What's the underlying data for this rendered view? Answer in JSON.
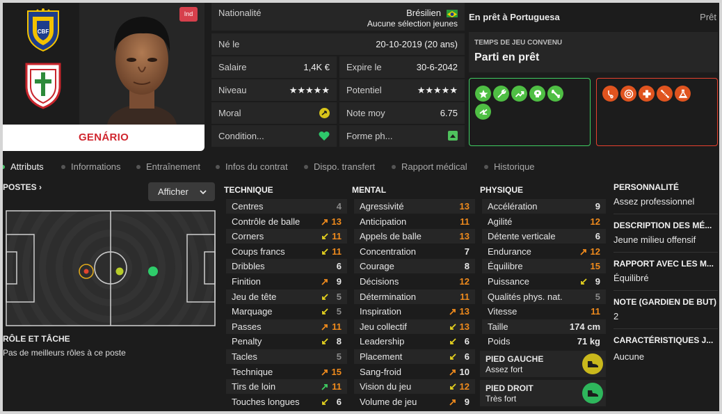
{
  "player": {
    "name": "GENÁRIO",
    "tag": "Ind"
  },
  "info": {
    "nationality_label": "Nationalité",
    "nationality_value": "Brésilien",
    "youth_caps": "Aucune sélection jeunes",
    "born_label": "Né le",
    "born_value": "20-10-2019 (20 ans)",
    "salary_label": "Salaire",
    "salary_value": "1,4K €",
    "expires_label": "Expire le",
    "expires_value": "30-6-2042",
    "level_label": "Niveau",
    "level_stars": "★★★★★",
    "potential_label": "Potentiel",
    "potential_stars": "★★★★★",
    "morale_label": "Moral",
    "avg_rating_label": "Note moy",
    "avg_rating_value": "6.75",
    "condition_label": "Condition...",
    "form_label": "Forme ph..."
  },
  "loan": {
    "title": "En prêt à Portuguesa",
    "status": "Prêt",
    "playing_time_label": "TEMPS DE JEU CONVENU",
    "playing_time_value": "Parti en prêt"
  },
  "traits": {
    "positive_icons": [
      "star-icon",
      "wrench-icon",
      "trend-up-icon",
      "brain-icon",
      "bone-icon",
      "arrows-icon"
    ],
    "negative_icons": [
      "stethoscope-icon",
      "target-icon",
      "medical-cross-icon",
      "broken-bone-icon",
      "flask-icon"
    ],
    "positive_color": "#4fd86e",
    "negative_color": "#e8412e"
  },
  "tabs": [
    {
      "label": "Attributs",
      "active": true
    },
    {
      "label": "Informations"
    },
    {
      "label": "Entraînement"
    },
    {
      "label": "Infos du contrat"
    },
    {
      "label": "Dispo. transfert"
    },
    {
      "label": "Rapport médical"
    },
    {
      "label": "Historique"
    }
  ],
  "positions": {
    "title": "POSTES",
    "show_button": "Afficher",
    "role_title": "RÔLE ET TÂCHE",
    "role_value": "Pas de meilleurs rôles à ce poste"
  },
  "technique": {
    "title": "TECHNIQUE",
    "rows": [
      {
        "name": "Centres",
        "value": "4",
        "arrow": ""
      },
      {
        "name": "Contrôle de balle",
        "value": "13",
        "arrow": "up"
      },
      {
        "name": "Corners",
        "value": "11",
        "arrow": "down"
      },
      {
        "name": "Coups francs",
        "value": "11",
        "arrow": "down"
      },
      {
        "name": "Dribbles",
        "value": "6",
        "arrow": ""
      },
      {
        "name": "Finition",
        "value": "9",
        "arrow": "up"
      },
      {
        "name": "Jeu de tête",
        "value": "5",
        "arrow": "down"
      },
      {
        "name": "Marquage",
        "value": "5",
        "arrow": "down"
      },
      {
        "name": "Passes",
        "value": "11",
        "arrow": "up"
      },
      {
        "name": "Penalty",
        "value": "8",
        "arrow": "down"
      },
      {
        "name": "Tacles",
        "value": "5",
        "arrow": ""
      },
      {
        "name": "Technique",
        "value": "15",
        "arrow": "up"
      },
      {
        "name": "Tirs de loin",
        "value": "11",
        "arrow": "green"
      },
      {
        "name": "Touches longues",
        "value": "6",
        "arrow": "down"
      }
    ]
  },
  "mental": {
    "title": "MENTAL",
    "rows": [
      {
        "name": "Agressivité",
        "value": "13",
        "arrow": ""
      },
      {
        "name": "Anticipation",
        "value": "11",
        "arrow": ""
      },
      {
        "name": "Appels de balle",
        "value": "13",
        "arrow": ""
      },
      {
        "name": "Concentration",
        "value": "7",
        "arrow": ""
      },
      {
        "name": "Courage",
        "value": "8",
        "arrow": ""
      },
      {
        "name": "Décisions",
        "value": "12",
        "arrow": ""
      },
      {
        "name": "Détermination",
        "value": "11",
        "arrow": ""
      },
      {
        "name": "Inspiration",
        "value": "13",
        "arrow": "up"
      },
      {
        "name": "Jeu collectif",
        "value": "13",
        "arrow": "down"
      },
      {
        "name": "Leadership",
        "value": "6",
        "arrow": "down"
      },
      {
        "name": "Placement",
        "value": "6",
        "arrow": "down"
      },
      {
        "name": "Sang-froid",
        "value": "10",
        "arrow": "up"
      },
      {
        "name": "Vision du jeu",
        "value": "12",
        "arrow": "down"
      },
      {
        "name": "Volume de jeu",
        "value": "9",
        "arrow": "up"
      }
    ]
  },
  "physique": {
    "title": "PHYSIQUE",
    "rows": [
      {
        "name": "Accélération",
        "value": "9",
        "arrow": ""
      },
      {
        "name": "Agilité",
        "value": "12",
        "arrow": ""
      },
      {
        "name": "Détente verticale",
        "value": "6",
        "arrow": ""
      },
      {
        "name": "Endurance",
        "value": "12",
        "arrow": "up"
      },
      {
        "name": "Équilibre",
        "value": "15",
        "arrow": ""
      },
      {
        "name": "Puissance",
        "value": "9",
        "arrow": "down"
      },
      {
        "name": "Qualités phys. nat.",
        "value": "5",
        "arrow": ""
      },
      {
        "name": "Vitesse",
        "value": "11",
        "arrow": ""
      },
      {
        "name": "Taille",
        "value": "174 cm",
        "arrow": ""
      },
      {
        "name": "Poids",
        "value": "71 kg",
        "arrow": ""
      }
    ],
    "left_foot_label": "PIED GAUCHE",
    "left_foot_value": "Assez fort",
    "right_foot_label": "PIED DROIT",
    "right_foot_value": "Très fort"
  },
  "personality": {
    "personality_title": "PERSONNALITÉ",
    "personality_value": "Assez professionnel",
    "description_title": "DESCRIPTION DES MÉ...",
    "description_value": "Jeune milieu offensif",
    "relation_title": "RAPPORT AVEC LES M...",
    "relation_value": "Équilibré",
    "gk_rating_title": "NOTE (GARDIEN DE BUT)",
    "gk_rating_value": "2",
    "characteristics_title": "CARACTÉRISTIQUES J...",
    "characteristics_value": "Aucune"
  },
  "colors": {
    "high_value": "#ef8a1c",
    "name_red": "#d0262e",
    "active_tab_dot": "#4ac16a"
  }
}
